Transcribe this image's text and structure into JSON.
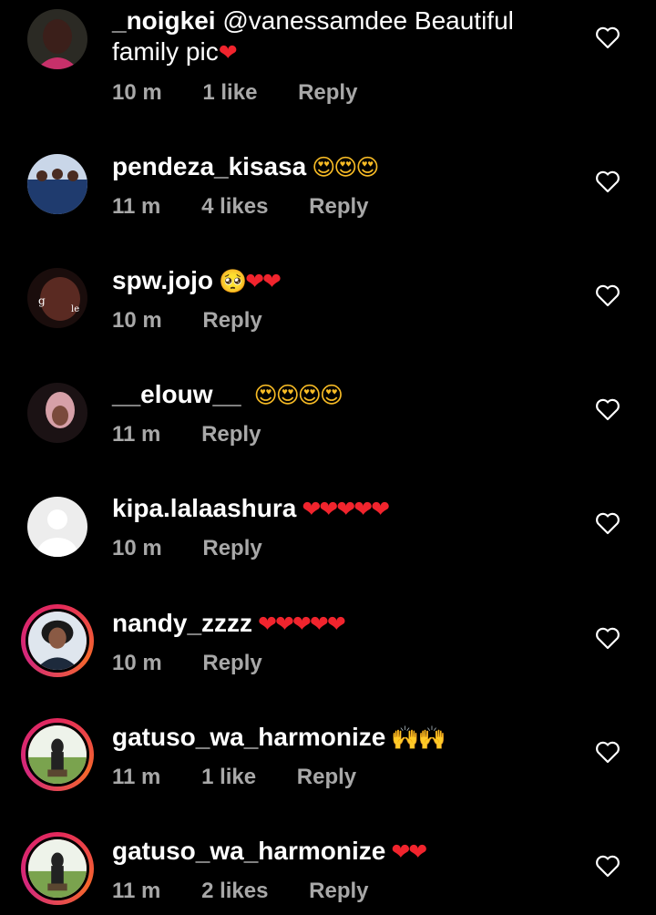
{
  "comments": [
    {
      "username": "_noigkei",
      "text": "@vanessamdee Beautiful",
      "text2": "family pic",
      "emoji": "❤",
      "time": "10 m",
      "likes": "1 like",
      "reply": "Reply"
    },
    {
      "username": "pendeza_kisasa",
      "emoji": "😍😍😍",
      "time": "11 m",
      "likes": "4 likes",
      "reply": "Reply"
    },
    {
      "username": "spw.jojo",
      "emoji": "🥺❤❤",
      "time": "10 m",
      "reply": "Reply"
    },
    {
      "username": "__elouw__",
      "emoji": "😍😍😍😍",
      "time": "11 m",
      "reply": "Reply"
    },
    {
      "username": "kipa.lalaashura",
      "emoji": "❤❤❤❤❤",
      "time": "10 m",
      "reply": "Reply"
    },
    {
      "username": "nandy_zzzz",
      "emoji": "❤❤❤❤❤",
      "time": "10 m",
      "reply": "Reply"
    },
    {
      "username": "gatuso_wa_harmonize",
      "emoji": "🙌🙌",
      "time": "11 m",
      "likes": "1 like",
      "reply": "Reply"
    },
    {
      "username": "gatuso_wa_harmonize",
      "emoji": "❤❤",
      "time": "11 m",
      "likes": "2 likes",
      "reply": "Reply"
    }
  ],
  "icons": {
    "like": "heart-outline-icon",
    "default_avatar": "default-avatar-icon"
  },
  "colors": {
    "background": "#000000",
    "text": "#ffffff",
    "meta": "#a8a8a8",
    "story_ring": "#e3285c"
  }
}
